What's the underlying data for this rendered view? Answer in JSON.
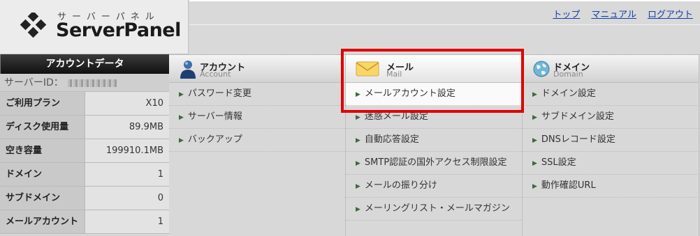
{
  "logo": {
    "kana": "サーバーパネル",
    "name": "ServerPanel"
  },
  "toplinks": [
    "トップ",
    "マニュアル",
    "ログアウト"
  ],
  "account_data": {
    "title": "アカウントデータ",
    "server_id_label": "サーバーID：",
    "rows": [
      {
        "label": "ご利用プラン",
        "value": "X10"
      },
      {
        "label": "ディスク使用量",
        "value": "89.9MB"
      },
      {
        "label": "空き容量",
        "value": "199910.1MB"
      },
      {
        "label": "ドメイン",
        "value": "1"
      },
      {
        "label": "サブドメイン",
        "value": "0"
      },
      {
        "label": "メールアカウント",
        "value": "1"
      }
    ]
  },
  "columns": [
    {
      "title": "アカウント",
      "subtitle": "Account",
      "icon": "user-icon",
      "items": [
        "パスワード変更",
        "サーバー情報",
        "バックアップ"
      ]
    },
    {
      "title": "メール",
      "subtitle": "Mail",
      "icon": "envelope-icon",
      "items": [
        "メールアカウント設定",
        "迷惑メール設定",
        "自動応答設定",
        "SMTP認証の国外アクセス制限設定",
        "メールの振り分け",
        "メーリングリスト・メールマガジン"
      ]
    },
    {
      "title": "ドメイン",
      "subtitle": "Domain",
      "icon": "globe-icon",
      "items": [
        "ドメイン設定",
        "サブドメイン設定",
        "DNSレコード設定",
        "SSL設定",
        "動作確認URL"
      ]
    }
  ],
  "colors": {
    "highlight": "#e00000",
    "link": "#1540a8"
  }
}
